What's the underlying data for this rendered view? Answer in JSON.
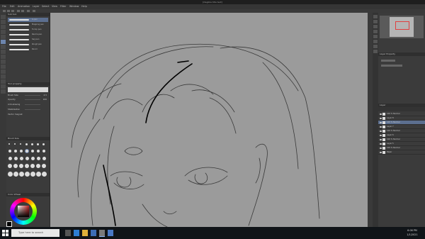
{
  "window": {
    "title": "[illegible title text]"
  },
  "menubar": {
    "items": [
      "File",
      "Edit",
      "Animation",
      "Layer",
      "Select",
      "View",
      "Filter",
      "Window",
      "Help"
    ]
  },
  "left_panel": {
    "subtool_header": "Sub tool",
    "brushes": [
      {
        "label": "G-pen"
      },
      {
        "label": "Mapping pen"
      },
      {
        "label": "Turnip pen"
      },
      {
        "label": "Real G-pen"
      },
      {
        "label": "Saji pen"
      },
      {
        "label": "Rough pen"
      },
      {
        "label": "Pencil"
      }
    ],
    "tool_property_header": "Tool property",
    "properties": [
      {
        "label": "Brush Size",
        "value": "4.5"
      },
      {
        "label": "Opacity",
        "value": "100"
      },
      {
        "label": "Anti-aliasing",
        "value": ""
      },
      {
        "label": "Stabilization",
        "value": ""
      },
      {
        "label": "Vector magnet",
        "value": ""
      }
    ],
    "brush_size_header": "Brush Size",
    "color_wheel_header": "Color Wheel"
  },
  "right_panel": {
    "navigator_header": "Navigator",
    "layer_property_header": "Layer Property",
    "layer_header": "Layer",
    "layers": [
      {
        "name": "100 % Normal",
        "selected": false
      },
      {
        "name": "Layer 8",
        "selected": false
      },
      {
        "name": "100 % Normal",
        "selected": true
      },
      {
        "name": "Layer 7",
        "selected": false
      },
      {
        "name": "100 % Normal",
        "selected": false
      },
      {
        "name": "Layer 6",
        "selected": false
      },
      {
        "name": "100 % Normal",
        "selected": false
      },
      {
        "name": "Layer 5",
        "selected": false
      },
      {
        "name": "100 % Normal",
        "selected": false
      },
      {
        "name": "Paper",
        "selected": false
      }
    ]
  },
  "taskbar": {
    "search_placeholder": "Type here to search",
    "time": "6:06 PM",
    "date": "1/1/2021"
  },
  "colors": {
    "canvas": "#9b9b9b",
    "panel": "#3b3b3b",
    "selection": "#5c6f8f",
    "main_color": "#000000"
  }
}
